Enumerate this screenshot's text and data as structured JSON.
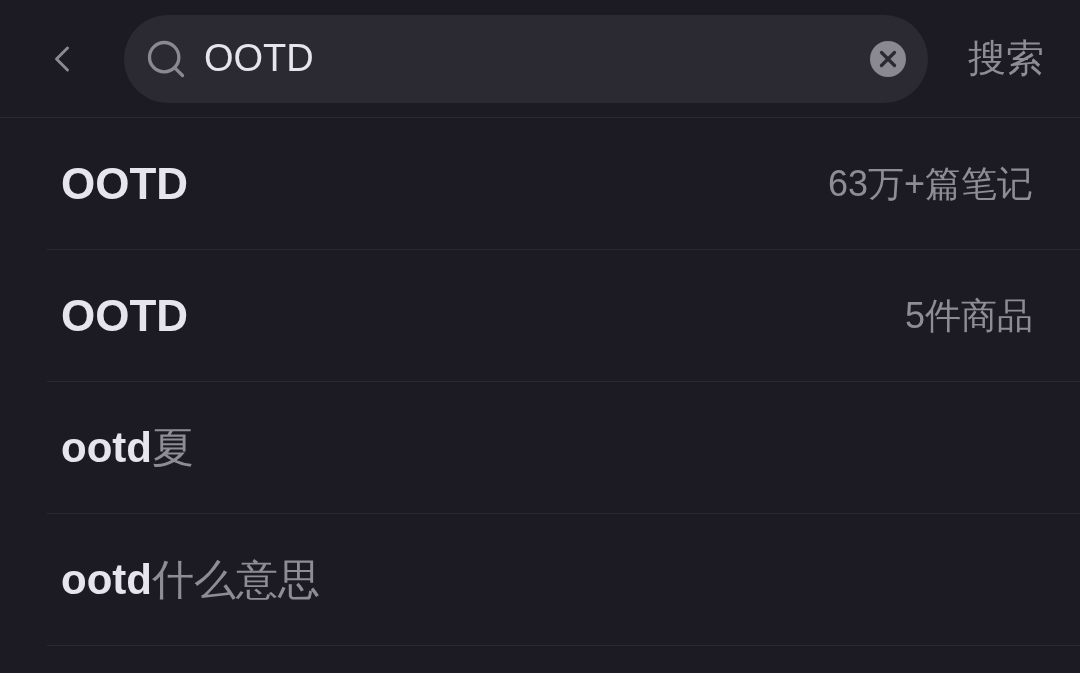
{
  "search": {
    "value": "OOTD"
  },
  "search_button": "搜索",
  "suggestions": [
    {
      "kind": "entity",
      "text": "OOTD",
      "meta": "63万+篇笔记"
    },
    {
      "kind": "entity",
      "text": "OOTD",
      "meta": "5件商品"
    },
    {
      "kind": "suggestion",
      "text": "**ootd**夏"
    },
    {
      "kind": "suggestion",
      "text": "**ootd**什么意思"
    }
  ]
}
